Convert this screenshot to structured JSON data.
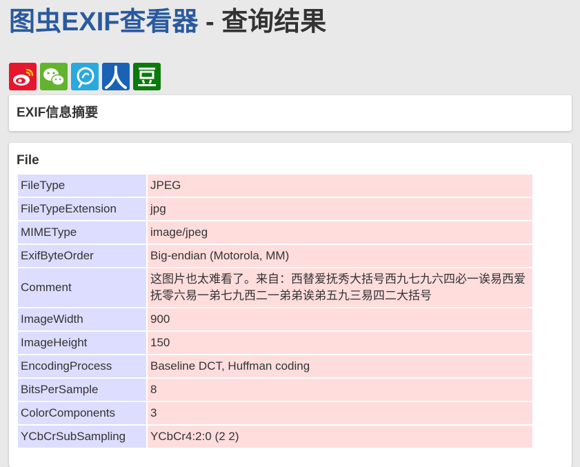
{
  "header": {
    "title_brand": "图虫EXIF查看器",
    "title_rest": " - 查询结果"
  },
  "share": [
    {
      "name": "weibo-icon",
      "color": "#e6162d"
    },
    {
      "name": "wechat-icon",
      "color": "#62b32e"
    },
    {
      "name": "qzone-icon",
      "color": "#2aa9dc"
    },
    {
      "name": "renren-icon",
      "color": "#1a62b6"
    },
    {
      "name": "douban-icon",
      "color": "#0b7a0b"
    }
  ],
  "summary": {
    "title": "EXIF信息摘要"
  },
  "file_section": {
    "title": "File",
    "rows": [
      {
        "key": "FileType",
        "value": "JPEG"
      },
      {
        "key": "FileTypeExtension",
        "value": "jpg"
      },
      {
        "key": "MIMEType",
        "value": "image/jpeg"
      },
      {
        "key": "ExifByteOrder",
        "value": "Big-endian (Motorola, MM)"
      },
      {
        "key": "Comment",
        "value": "这图片也太难看了。来自：西替爱抚秀大括号西九七九六四必一诶易西爱抚零六易一弟七九西二一弟弟诶弟五九三易四二大括号"
      },
      {
        "key": "ImageWidth",
        "value": "900"
      },
      {
        "key": "ImageHeight",
        "value": "150"
      },
      {
        "key": "EncodingProcess",
        "value": "Baseline DCT, Huffman coding"
      },
      {
        "key": "BitsPerSample",
        "value": "8"
      },
      {
        "key": "ColorComponents",
        "value": "3"
      },
      {
        "key": "YCbCrSubSampling",
        "value": "YCbCr4:2:0 (2 2)"
      }
    ]
  }
}
